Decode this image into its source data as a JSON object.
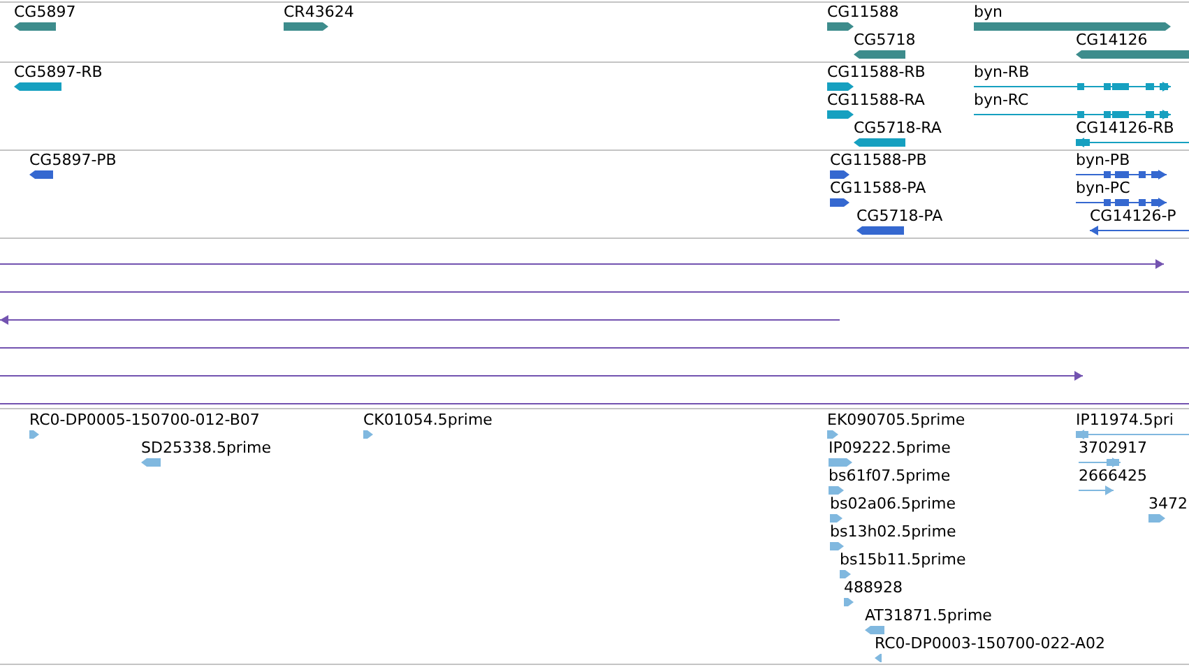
{
  "tracks": [
    {
      "kind": "gene",
      "features": [
        {
          "label": "CG5897",
          "reverse": true,
          "kind": "block"
        },
        {
          "label": "CR43624",
          "reverse": false,
          "kind": "block"
        },
        {
          "label": "CG11588",
          "reverse": false,
          "kind": "block"
        },
        {
          "label": "CG5718",
          "reverse": true,
          "kind": "block"
        },
        {
          "label": "byn",
          "reverse": false,
          "kind": "block"
        },
        {
          "label": "CG14126",
          "reverse": true,
          "kind": "block"
        }
      ]
    },
    {
      "kind": "transcript",
      "features": [
        {
          "label": "CG5897-RB",
          "reverse": true,
          "kind": "block"
        },
        {
          "label": "CG11588-RB",
          "reverse": false,
          "kind": "block"
        },
        {
          "label": "CG11588-RA",
          "reverse": false,
          "kind": "block"
        },
        {
          "label": "CG5718-RA",
          "reverse": true,
          "kind": "block"
        },
        {
          "label": "byn-RB",
          "reverse": false,
          "kind": "line"
        },
        {
          "label": "byn-RC",
          "reverse": false,
          "kind": "line"
        },
        {
          "label": "CG14126-RB",
          "reverse": true,
          "kind": "line"
        }
      ]
    },
    {
      "kind": "protein",
      "features": [
        {
          "label": "CG5897-PB",
          "reverse": true,
          "kind": "block"
        },
        {
          "label": "CG11588-PB",
          "reverse": false,
          "kind": "block"
        },
        {
          "label": "CG11588-PA",
          "reverse": false,
          "kind": "block"
        },
        {
          "label": "CG5718-PA",
          "reverse": true,
          "kind": "block"
        },
        {
          "label": "byn-PB",
          "reverse": false,
          "kind": "line"
        },
        {
          "label": "byn-PC",
          "reverse": false,
          "kind": "line"
        },
        {
          "label": "CG14126-P",
          "reverse": true,
          "kind": "line"
        }
      ]
    },
    {
      "kind": "alignment",
      "features": [
        {
          "reverse": false,
          "arrowhead": true,
          "kind": "line"
        },
        {
          "arrowhead": false,
          "kind": "line"
        },
        {
          "reverse": true,
          "arrowhead": true,
          "kind": "line"
        },
        {
          "arrowhead": false,
          "kind": "line"
        },
        {
          "reverse": false,
          "arrowhead": true,
          "kind": "line"
        },
        {
          "arrowhead": false,
          "kind": "line"
        }
      ]
    },
    {
      "kind": "est",
      "features": [
        {
          "label": "RC0-DP0005-150700-012-B07",
          "reverse": false,
          "kind": "block"
        },
        {
          "label": "SD25338.5prime",
          "reverse": true,
          "kind": "block"
        },
        {
          "label": "CK01054.5prime",
          "reverse": false,
          "kind": "block"
        },
        {
          "label": "EK090705.5prime",
          "reverse": false,
          "kind": "block"
        },
        {
          "label": "IP09222.5prime",
          "reverse": false,
          "kind": "block"
        },
        {
          "label": "bs61f07.5prime",
          "reverse": false,
          "kind": "block"
        },
        {
          "label": "bs02a06.5prime",
          "reverse": false,
          "kind": "block"
        },
        {
          "label": "bs13h02.5prime",
          "reverse": false,
          "kind": "block"
        },
        {
          "label": "bs15b11.5prime",
          "reverse": false,
          "kind": "block"
        },
        {
          "label": "488928",
          "reverse": false,
          "kind": "block"
        },
        {
          "label": "AT31871.5prime",
          "reverse": true,
          "kind": "block"
        },
        {
          "label": "RC0-DP0003-150700-022-A02",
          "reverse": true,
          "kind": "block"
        },
        {
          "label": "IP11974.5pri",
          "reverse": true,
          "kind": "line"
        },
        {
          "label": "3702917",
          "reverse": false,
          "kind": "line"
        },
        {
          "label": "2666425",
          "reverse": false,
          "kind": "line"
        },
        {
          "label": "3472",
          "reverse": false,
          "kind": "block"
        }
      ]
    }
  ]
}
